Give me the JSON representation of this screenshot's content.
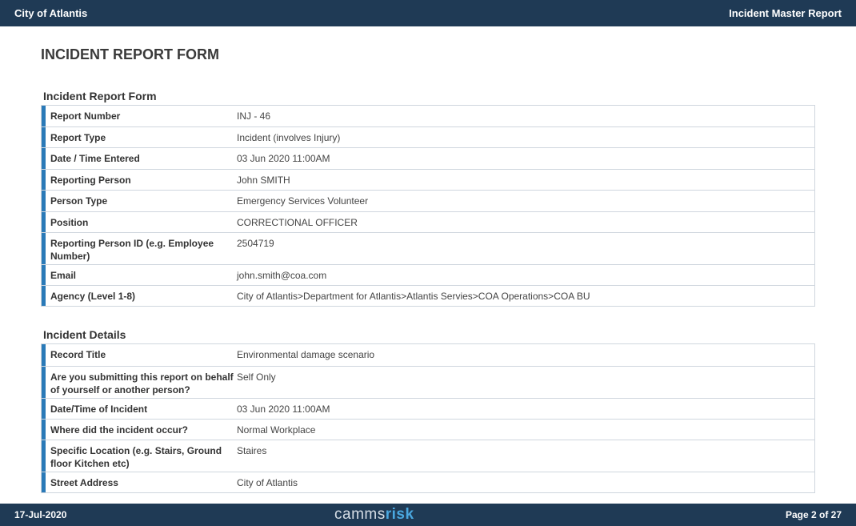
{
  "header": {
    "org_name": "City of Atlantis",
    "report_name": "Incident Master Report"
  },
  "page_title": "INCIDENT REPORT FORM",
  "sections": [
    {
      "title": "Incident Report Form",
      "rows": [
        {
          "label": "Report Number",
          "value": "INJ - 46"
        },
        {
          "label": "Report Type",
          "value": "Incident (involves Injury)"
        },
        {
          "label": "Date / Time Entered",
          "value": "03 Jun 2020 11:00AM"
        },
        {
          "label": "Reporting Person",
          "value": "John SMITH"
        },
        {
          "label": "Person Type",
          "value": "Emergency Services Volunteer"
        },
        {
          "label": "Position",
          "value": "CORRECTIONAL OFFICER"
        },
        {
          "label": "Reporting Person ID (e.g. Employee Number)",
          "value": "2504719"
        },
        {
          "label": "Email",
          "value": "john.smith@coa.com"
        },
        {
          "label": "Agency (Level 1-8)",
          "value": "City of Atlantis>Department for Atlantis>Atlantis Servies>COA Operations>COA BU"
        }
      ]
    },
    {
      "title": "Incident Details",
      "rows": [
        {
          "label": "Record Title",
          "value": "Environmental damage scenario"
        },
        {
          "label": "Are you submitting this report on behalf of yourself or another person?",
          "value": "Self Only"
        },
        {
          "label": "Date/Time of Incident",
          "value": "03 Jun 2020 11:00AM"
        },
        {
          "label": "Where did the incident occur?",
          "value": "Normal Workplace"
        },
        {
          "label": "Specific Location (e.g. Stairs, Ground floor Kitchen etc)",
          "value": "Staires"
        },
        {
          "label": "Street Address",
          "value": "City of Atlantis"
        }
      ]
    }
  ],
  "footer": {
    "date": "17-Jul-2020",
    "logo_part1": "camms",
    "logo_part2": "risk",
    "page_info": "Page 2 of 27"
  },
  "colors": {
    "bar": "#1f3a55",
    "accent": "#2a7ab8",
    "logo_accent": "#4aa8e0"
  }
}
